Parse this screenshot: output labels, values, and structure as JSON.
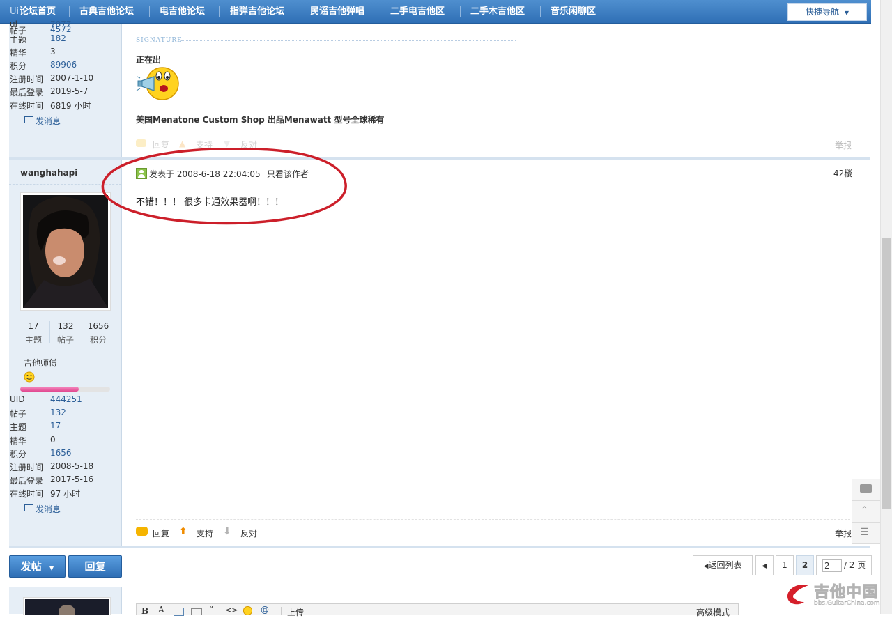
{
  "nav": {
    "items": [
      "论坛首页",
      "古典吉他论坛",
      "电吉他论坛",
      "指弹吉他论坛",
      "民谣吉他弹唱",
      "二手电吉他区",
      "二手木吉他区",
      "音乐闲聊区"
    ],
    "quick_nav": "快捷导航",
    "behind_text": "Ui"
  },
  "prev_post": {
    "sidebar": {
      "partial_top": "7877",
      "rows": [
        {
          "label": "帖子",
          "value": "4572"
        },
        {
          "label": "主题",
          "value": "182"
        },
        {
          "label": "精华",
          "value": "3"
        },
        {
          "label": "积分",
          "value": "89906"
        },
        {
          "label": "注册时间",
          "value": "2007-1-10"
        },
        {
          "label": "最后登录",
          "value": "2019-5-7"
        },
        {
          "label": "在线时间",
          "value": "6819 小时"
        }
      ],
      "message_link": "发消息"
    },
    "signature_label": "SIGNATURE",
    "signature_text": "正在出",
    "signature_note": "美国Menatone Custom Shop 出品Menawatt 型号全球稀有",
    "actions": {
      "reply": "回复",
      "support": "支持",
      "oppose": "反对",
      "report": "举报"
    }
  },
  "post": {
    "author": "wanghahapi",
    "stats": [
      {
        "value": "17",
        "label": "主题"
      },
      {
        "value": "132",
        "label": "帖子"
      },
      {
        "value": "1656",
        "label": "积分"
      }
    ],
    "rank": "吉他师傅",
    "rows": [
      {
        "label": "UID",
        "value": "444251"
      },
      {
        "label": "帖子",
        "value": "132"
      },
      {
        "label": "主题",
        "value": "17"
      },
      {
        "label": "精华",
        "value": "0"
      },
      {
        "label": "积分",
        "value": "1656"
      },
      {
        "label": "注册时间",
        "value": "2008-5-18"
      },
      {
        "label": "最后登录",
        "value": "2017-5-16"
      },
      {
        "label": "在线时间",
        "value": "97 小时"
      }
    ],
    "message_link": "发消息",
    "posted_at": "发表于 2008-6-18 22:04:05",
    "author_only": "只看该作者",
    "floor": "42楼",
    "content": "不错！！！ 很多卡通效果器啊！！！",
    "actions": {
      "reply": "回复",
      "support": "支持",
      "oppose": "反对",
      "report": "举报"
    }
  },
  "bottom": {
    "new_post": "发帖",
    "reply": "回复",
    "back_to_list": "返回列表",
    "pages": [
      "1",
      "2"
    ],
    "current_page": "2",
    "page_input": "2",
    "total_pages": "/ 2 页"
  },
  "editor": {
    "toolbar": [
      "B",
      "A",
      "上传",
      "高级模式"
    ]
  },
  "watermark": {
    "brand": "吉他中国",
    "url": "bbs.GuitarChina.com"
  },
  "colors": {
    "nav": "#2f6fb5",
    "link": "#2c5f98",
    "annotation": "#cc1f2a",
    "sidebar": "#e6eef6"
  }
}
